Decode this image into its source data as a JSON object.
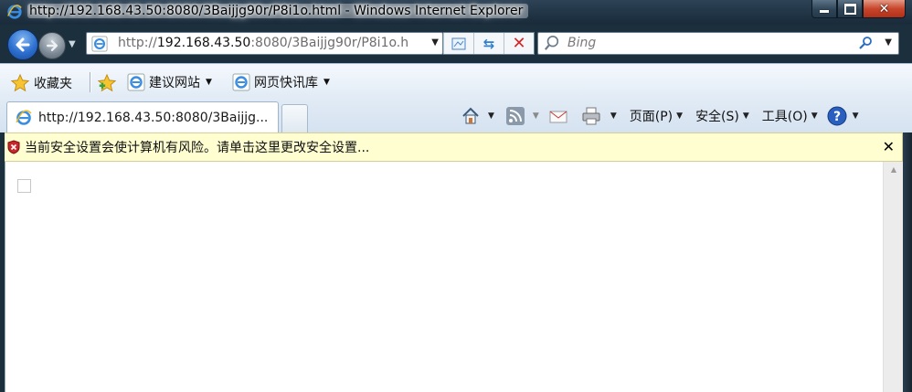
{
  "window": {
    "title": "http://192.168.43.50:8080/3Baijjg90r/P8i1o.html - Windows Internet Explorer",
    "controls": {
      "minimize": "minimize",
      "maximize": "maximize",
      "close": "✕"
    }
  },
  "address_bar": {
    "url_host": "192.168.43.50",
    "url_prefix": "http://",
    "url_rest": ":8080/3Baijjg90r/P8i1o.h",
    "dropdown": "▼"
  },
  "address_buttons": {
    "compat": "compatibility-view-icon",
    "refresh": "⇆",
    "stop": "✕"
  },
  "search": {
    "placeholder": "Bing",
    "dropdown": "▼"
  },
  "favorites_bar": {
    "favorites_label": "收藏夹",
    "suggested_sites": "建议网站",
    "web_slices": "网页快讯库"
  },
  "tab": {
    "title": "http://192.168.43.50:8080/3Baijjg..."
  },
  "command_bar": {
    "page": "页面(P)",
    "safety": "安全(S)",
    "tools": "工具(O)"
  },
  "info_bar": {
    "message": "当前安全设置会使计算机有风险。请单击这里更改安全设置...",
    "close": "✕"
  },
  "colors": {
    "info_bar_bg": "#fefed0",
    "frame": "#1b2f3d",
    "close_button": "#c7462b",
    "accent_blue": "#2d6fd0"
  }
}
